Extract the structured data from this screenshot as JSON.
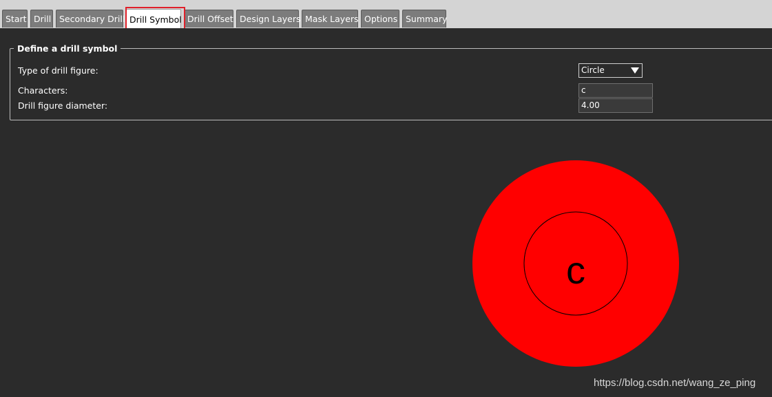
{
  "tabs": [
    {
      "label": "Start",
      "active": false
    },
    {
      "label": "Drill",
      "active": false
    },
    {
      "label": "Secondary Drill",
      "active": false
    },
    {
      "label": "Drill Symbol",
      "active": true
    },
    {
      "label": "Drill Offset",
      "active": false
    },
    {
      "label": "Design Layers",
      "active": false
    },
    {
      "label": "Mask Layers",
      "active": false
    },
    {
      "label": "Options",
      "active": false
    },
    {
      "label": "Summary",
      "active": false
    }
  ],
  "group": {
    "title": "Define a drill symbol",
    "figure_type_label": "Type of drill figure:",
    "figure_type_value": "Circle",
    "characters_label": "Characters:",
    "characters_value": "c",
    "diameter_label": "Drill figure diameter:",
    "diameter_value": "4.00"
  },
  "preview": {
    "character": "c",
    "fill_color": "#ff0000",
    "ring_color": "#000000"
  },
  "highlight_color": "#e0202a",
  "watermark": "https://blog.csdn.net/wang_ze_ping"
}
